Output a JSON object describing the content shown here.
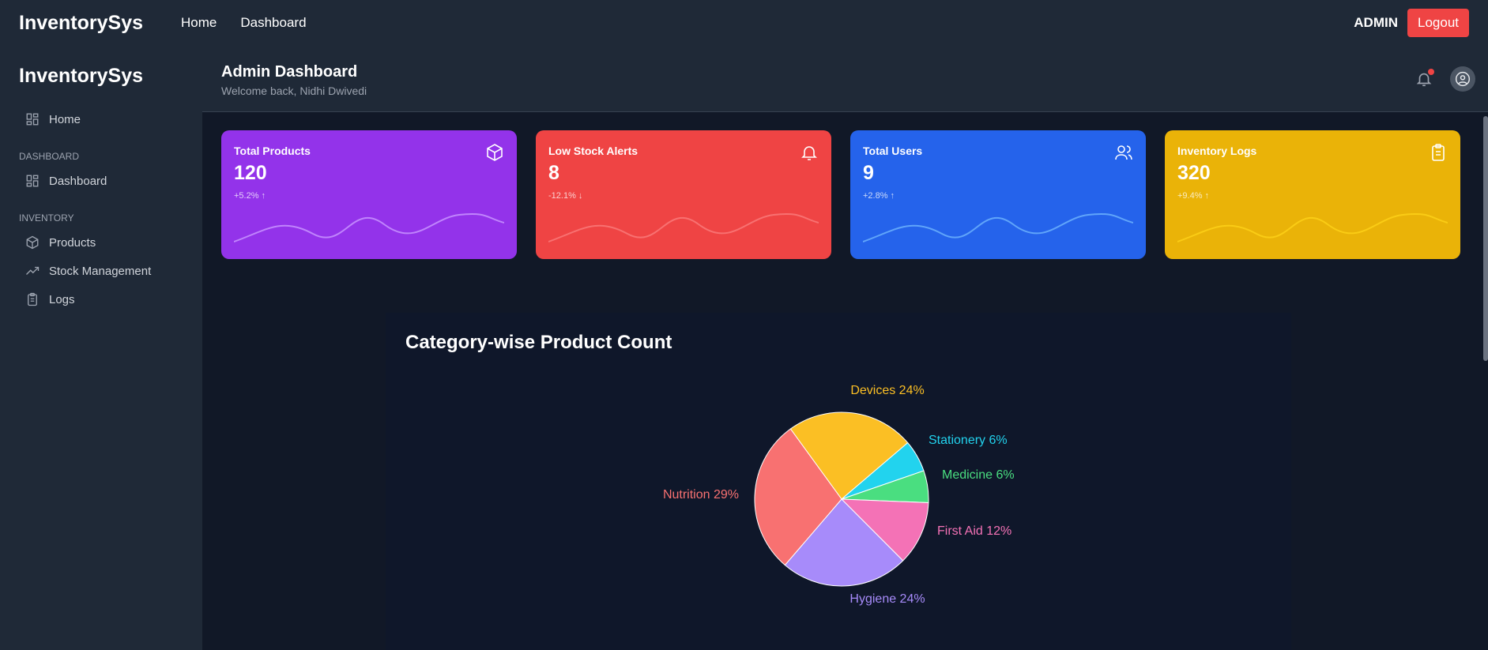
{
  "topbar": {
    "brand": "InventorySys",
    "nav": [
      {
        "label": "Home"
      },
      {
        "label": "Dashboard"
      }
    ],
    "user_label": "ADMIN",
    "logout_label": "Logout"
  },
  "sidebar": {
    "brand": "InventorySys",
    "home_label": "Home",
    "sections": [
      {
        "title": "DASHBOARD",
        "items": [
          {
            "label": "Dashboard",
            "icon": "grid-icon"
          }
        ]
      },
      {
        "title": "INVENTORY",
        "items": [
          {
            "label": "Products",
            "icon": "box-icon"
          },
          {
            "label": "Stock Management",
            "icon": "trending-up-icon"
          },
          {
            "label": "Logs",
            "icon": "clipboard-icon"
          }
        ]
      }
    ]
  },
  "header": {
    "title": "Admin Dashboard",
    "subtitle": "Welcome back, Nidhi Dwivedi"
  },
  "cards": [
    {
      "title": "Total Products",
      "value": "120",
      "change": "+5.2% ↑",
      "icon": "box-icon",
      "color": "#9333ea",
      "wave": "#c084fc"
    },
    {
      "title": "Low Stock Alerts",
      "value": "8",
      "change": "-12.1% ↓",
      "icon": "bell-icon",
      "color": "#ef4444",
      "wave": "#f87171"
    },
    {
      "title": "Total Users",
      "value": "9",
      "change": "+2.8% ↑",
      "icon": "users-icon",
      "color": "#2563eb",
      "wave": "#60a5fa"
    },
    {
      "title": "Inventory Logs",
      "value": "320",
      "change": "+9.4% ↑",
      "icon": "clipboard-icon",
      "color": "#eab308",
      "wave": "#facc15"
    }
  ],
  "chart_data": {
    "type": "pie",
    "title": "Category-wise Product Count",
    "slices": [
      {
        "label": "Devices",
        "percent": 24,
        "color": "#fbbf24",
        "text": "Devices 24%"
      },
      {
        "label": "Stationery",
        "percent": 6,
        "color": "#22d3ee",
        "text": "Stationery 6%"
      },
      {
        "label": "Medicine",
        "percent": 6,
        "color": "#4ade80",
        "text": "Medicine 6%"
      },
      {
        "label": "First Aid",
        "percent": 12,
        "color": "#f472b6",
        "text": "First Aid 12%"
      },
      {
        "label": "Hygiene",
        "percent": 24,
        "color": "#a78bfa",
        "text": "Hygiene 24%"
      },
      {
        "label": "Nutrition",
        "percent": 29,
        "color": "#f87171",
        "text": "Nutrition 29%"
      }
    ]
  }
}
